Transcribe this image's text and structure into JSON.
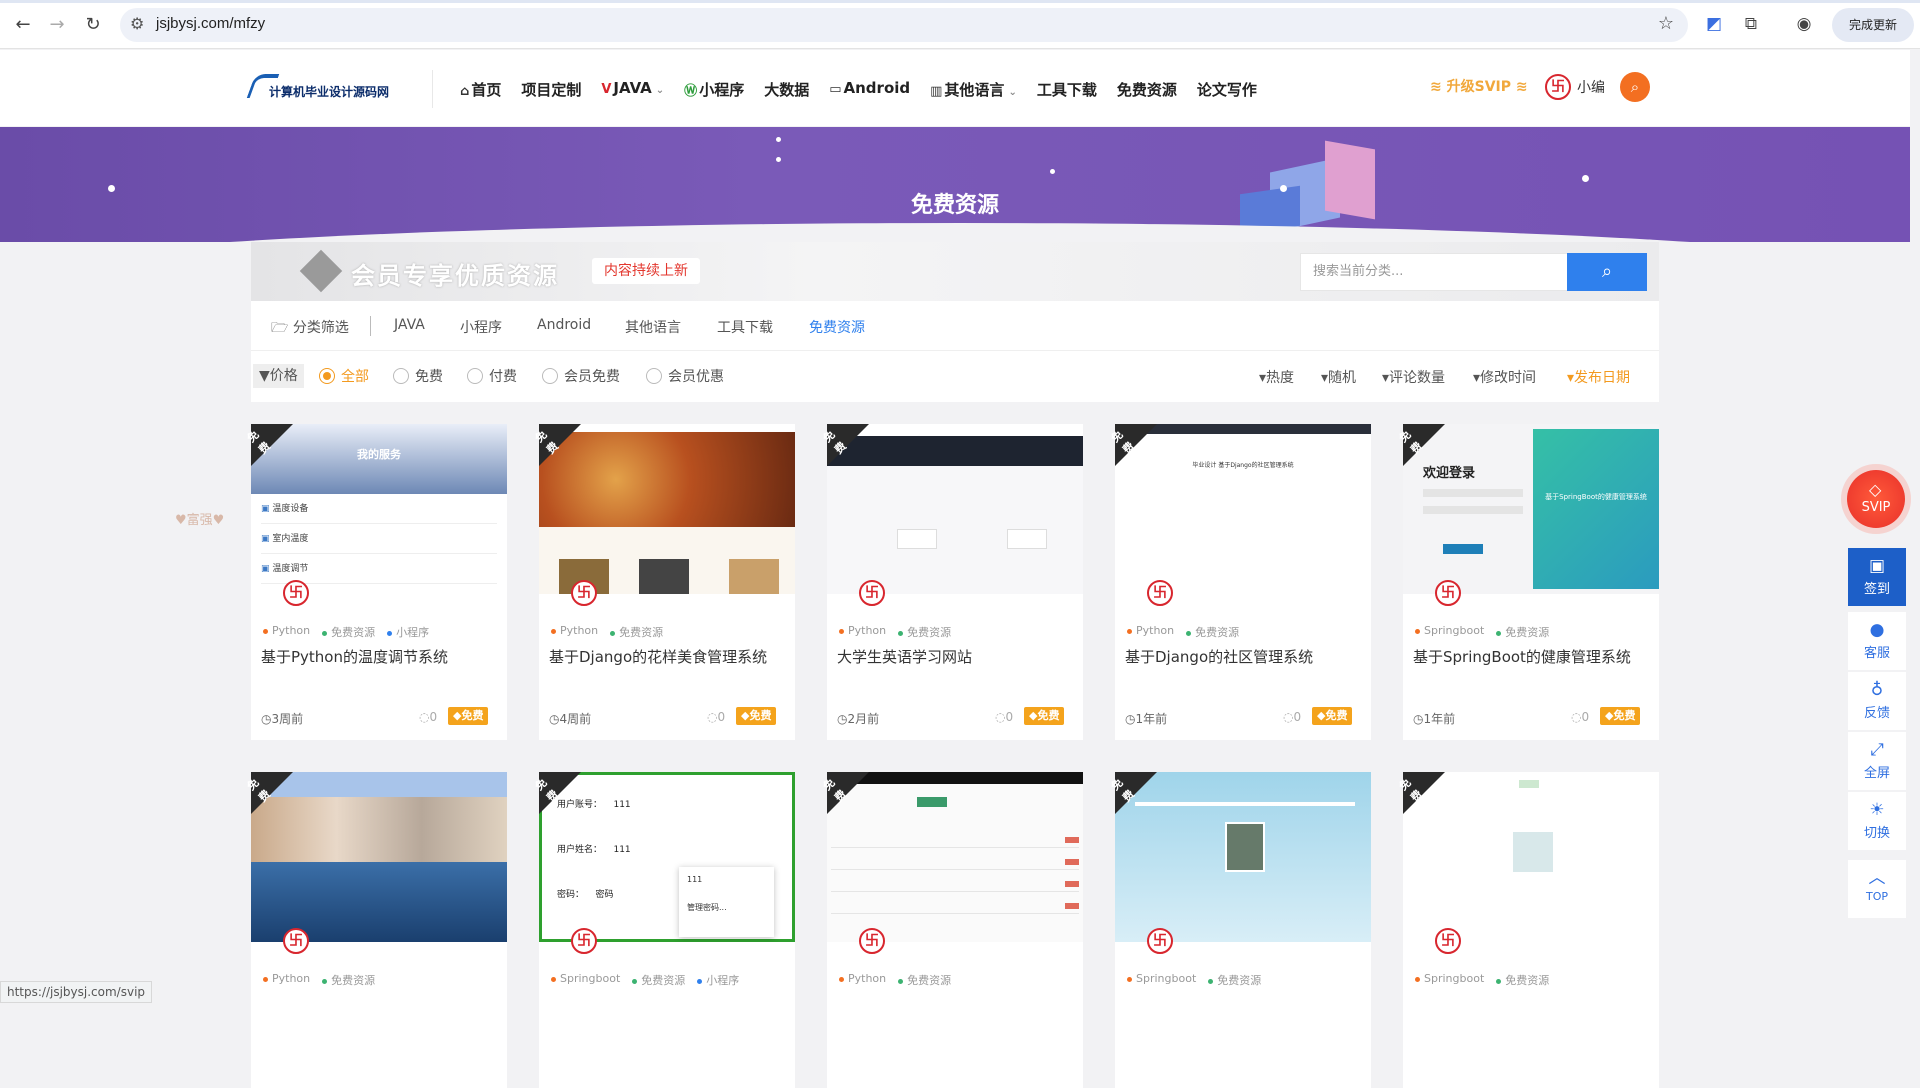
{
  "browser": {
    "url": "jsjbysj.com/mfzy",
    "update_label": "完成更新",
    "status_url": "https://jsjbysj.com/svip"
  },
  "header": {
    "logo_text": "计算机毕业设计源码网",
    "menu": [
      {
        "label": "首页",
        "icon": "home-icon",
        "dropdown": false
      },
      {
        "label": "项目定制",
        "icon": "",
        "dropdown": false
      },
      {
        "label": "JAVA",
        "icon": "v-icon",
        "dropdown": true
      },
      {
        "label": "小程序",
        "icon": "wordpress-icon",
        "dropdown": false
      },
      {
        "label": "大数据",
        "icon": "",
        "dropdown": false
      },
      {
        "label": "Android",
        "icon": "monitor-icon",
        "dropdown": false
      },
      {
        "label": "其他语言",
        "icon": "books-icon",
        "dropdown": true
      },
      {
        "label": "工具下载",
        "icon": "",
        "dropdown": false
      },
      {
        "label": "免费资源",
        "icon": "",
        "dropdown": false
      },
      {
        "label": "论文写作",
        "icon": "",
        "dropdown": false
      }
    ],
    "svip_label": "升级SVIP",
    "user_name": "小编"
  },
  "banner": {
    "title": "免费资源"
  },
  "vip_bar": {
    "text": "会员专享优质资源",
    "new_tag": "内容持续上新",
    "search_placeholder": "搜索当前分类..."
  },
  "categories": {
    "label": "分类筛选",
    "items": [
      "JAVA",
      "小程序",
      "Android",
      "其他语言",
      "工具下载",
      "免费资源"
    ],
    "active": "免费资源"
  },
  "filters": {
    "price_label": "价格",
    "options": [
      "全部",
      "免费",
      "付费",
      "会员免费",
      "会员优惠"
    ],
    "selected": "全部",
    "sorts": [
      "热度",
      "随机",
      "评论数量",
      "修改时间",
      "发布日期"
    ],
    "active_sort": "发布日期"
  },
  "ribbon_text": "免费",
  "free_badge": "免费",
  "decoration_text": "♥富强♥",
  "cards": [
    {
      "tags": [
        "Python",
        "免费资源",
        "小程序"
      ],
      "title": "基于Python的温度调节系统",
      "time": "3周前",
      "comments": "0",
      "thumb": "app"
    },
    {
      "tags": [
        "Python",
        "免费资源"
      ],
      "title": "基于Django的花样美食管理系统",
      "time": "4周前",
      "comments": "0",
      "thumb": "food"
    },
    {
      "tags": [
        "Python",
        "免费资源"
      ],
      "title": "大学生英语学习网站",
      "time": "2月前",
      "comments": "0",
      "thumb": "dark"
    },
    {
      "tags": [
        "Python",
        "免费资源"
      ],
      "title": "基于Django的社区管理系统",
      "time": "1年前",
      "comments": "0",
      "thumb": "blank"
    },
    {
      "tags": [
        "Springboot",
        "免费资源"
      ],
      "title": "基于SpringBoot的健康管理系统",
      "time": "1年前",
      "comments": "0",
      "thumb": "login"
    },
    {
      "tags": [
        "Python",
        "免费资源"
      ],
      "title": "",
      "time": "",
      "comments": "",
      "thumb": "city"
    },
    {
      "tags": [
        "Springboot",
        "免费资源",
        "小程序"
      ],
      "title": "",
      "time": "",
      "comments": "",
      "thumb": "form"
    },
    {
      "tags": [
        "Python",
        "免费资源"
      ],
      "title": "",
      "time": "",
      "comments": "",
      "thumb": "table"
    },
    {
      "tags": [
        "Springboot",
        "免费资源"
      ],
      "title": "",
      "time": "",
      "comments": "",
      "thumb": "map"
    },
    {
      "tags": [
        "Springboot",
        "免费资源"
      ],
      "title": "",
      "time": "",
      "comments": "",
      "thumb": "white"
    }
  ],
  "thumb_text": {
    "app_title": "我的服务",
    "app_rows": [
      "温度设备",
      "室内温度",
      "温度调节"
    ],
    "login_title": "欢迎登录",
    "login_banner": "基于SpringBoot的健康管理系统",
    "form_rows": [
      {
        "label": "用户账号：",
        "value": "111"
      },
      {
        "label": "用户姓名：",
        "value": "111"
      },
      {
        "label": "密码：",
        "value": "密码"
      }
    ],
    "form_popup": [
      "111",
      "管理密码..."
    ],
    "blank_caption": "毕业设计 基于Django的社区管理系统"
  },
  "sidebar": {
    "svip": "SVIP",
    "items": [
      {
        "label": "签到",
        "icon": "calendar-check-icon"
      },
      {
        "label": "客服",
        "icon": "headset-icon"
      },
      {
        "label": "反馈",
        "icon": "lightbulb-icon"
      },
      {
        "label": "全屏",
        "icon": "expand-icon"
      },
      {
        "label": "切换",
        "icon": "sun-icon"
      },
      {
        "label": "TOP",
        "icon": "arrow-up-icon"
      }
    ]
  },
  "colors": {
    "accent": "#f39a1f",
    "brand_blue": "#2f80ed",
    "banner_purple": "#6f50b2",
    "svip_red": "#e8302a",
    "tag_dots": [
      "#f36f21",
      "#3cb371",
      "#2f80ed"
    ]
  }
}
